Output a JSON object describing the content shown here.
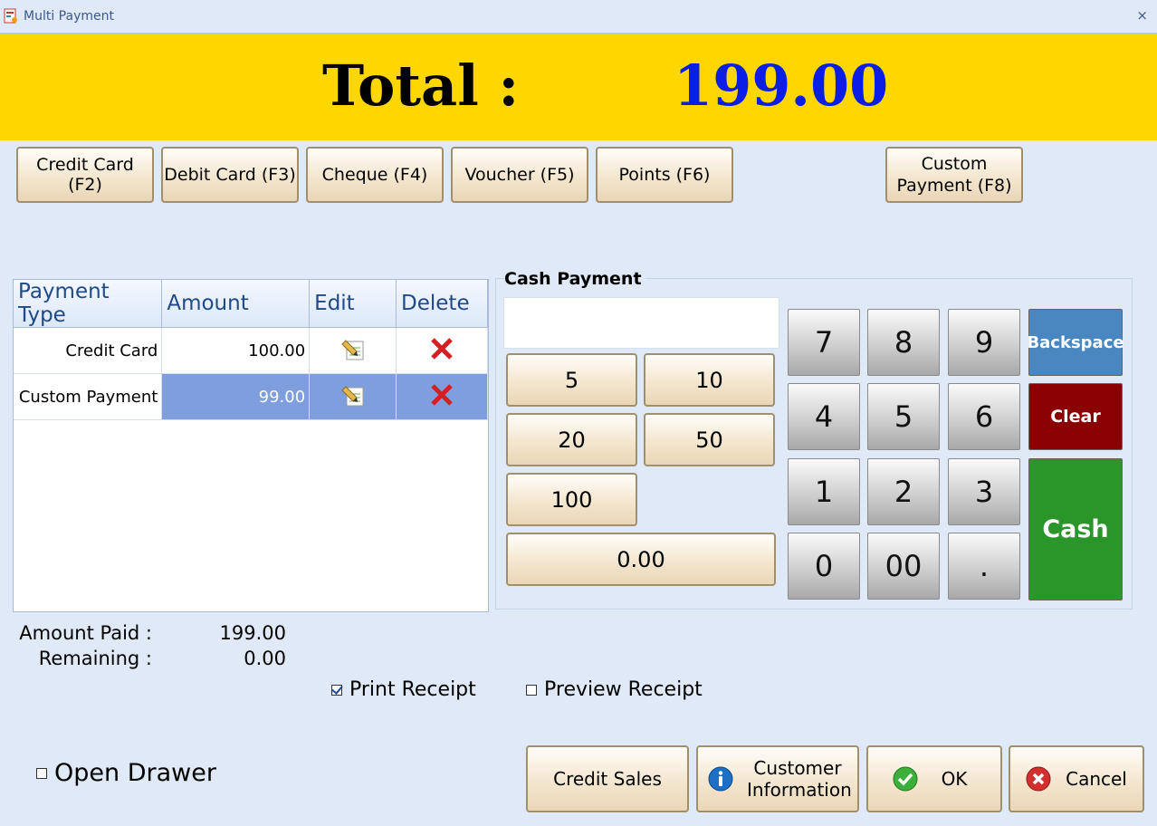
{
  "window": {
    "title": "Multi Payment",
    "close_glyph": "×",
    "icon": "app-icon"
  },
  "total": {
    "label": "Total :",
    "value": "199.00"
  },
  "payment_methods": [
    {
      "label": "Credit Card (F2)"
    },
    {
      "label": "Debit Card (F3)"
    },
    {
      "label": "Cheque (F4)"
    },
    {
      "label": "Voucher (F5)"
    },
    {
      "label": "Points (F6)"
    },
    {
      "label": "Custom Payment (F8)"
    }
  ],
  "grid": {
    "columns": [
      "Payment Type",
      "Amount",
      "Edit",
      "Delete"
    ],
    "rows": [
      {
        "type": "Credit Card",
        "amount": "100.00",
        "edit_icon": "pencil-icon",
        "delete_icon": "delete-x-icon"
      },
      {
        "type": "Custom Payment",
        "amount": "99.00",
        "edit_icon": "pencil-icon",
        "delete_icon": "delete-x-icon",
        "selected": true
      }
    ]
  },
  "cash_payment": {
    "title": "Cash Payment",
    "input_value": "",
    "quick_amounts": [
      "5",
      "10",
      "20",
      "50",
      "100"
    ],
    "amount": "0.00"
  },
  "keypad": {
    "keys": [
      "7",
      "8",
      "9",
      "4",
      "5",
      "6",
      "1",
      "2",
      "3",
      "0",
      "00",
      "."
    ],
    "backspace": "Backspace",
    "clear": "Clear",
    "cash": "Cash",
    "colors": {
      "backspace": "#4a86c0",
      "clear": "#8b0000",
      "cash": "#2a962a"
    }
  },
  "summary": {
    "paid_label": "Amount Paid :",
    "paid_value": "199.00",
    "remaining_label": "Remaining :",
    "remaining_value": "0.00"
  },
  "options": {
    "print_receipt": {
      "label": "Print Receipt",
      "checked": true
    },
    "preview_receipt": {
      "label": "Preview Receipt",
      "checked": false
    },
    "open_drawer": {
      "label": "Open Drawer",
      "checked": false
    }
  },
  "footer": {
    "credit_sales": "Credit Sales",
    "customer_information": "Customer Information",
    "ok": "OK",
    "cancel": "Cancel"
  },
  "colors": {
    "total_bar": "#ffd700",
    "total_value": "#0a1ee6",
    "selected_row": "#7f9edd"
  }
}
